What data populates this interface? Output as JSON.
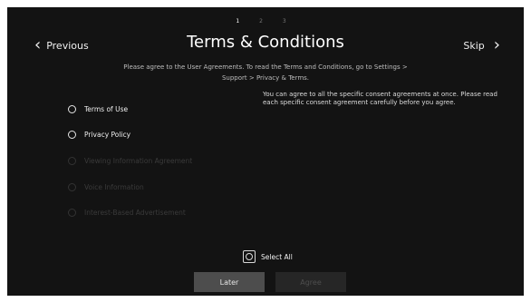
{
  "pager": {
    "dots": [
      "1",
      "2",
      "3"
    ]
  },
  "header": {
    "previous_label": "Previous",
    "title": "Terms & Conditions",
    "skip_label": "Skip",
    "subtitle_line1": "Please agree to the User Agreements. To read the Terms and Conditions, go to Settings >",
    "subtitle_line2": "Support > Privacy & Terms."
  },
  "agreements": [
    {
      "label": "Terms of Use",
      "enabled": true
    },
    {
      "label": "Privacy Policy",
      "enabled": true
    },
    {
      "label": "Viewing Information Agreement",
      "enabled": false
    },
    {
      "label": "Voice Information",
      "enabled": false
    },
    {
      "label": "Interest-Based Advertisement",
      "enabled": false
    }
  ],
  "note": "You can agree to all the specific consent agreements at once. Please read each specific consent agreement carefully before you agree.",
  "select_all_label": "Select All",
  "buttons": {
    "later": "Later",
    "agree": "Agree"
  },
  "icons": {
    "previous": "chevron-left-icon",
    "skip": "chevron-right-icon",
    "radio": "radio-circle-icon",
    "checkbox": "checkbox-icon"
  },
  "colors": {
    "background": "#131313",
    "text": "#f0f0f0",
    "disabled_text": "#3a3a3a",
    "later_button": "#4d4d4d",
    "agree_button": "#262626"
  }
}
